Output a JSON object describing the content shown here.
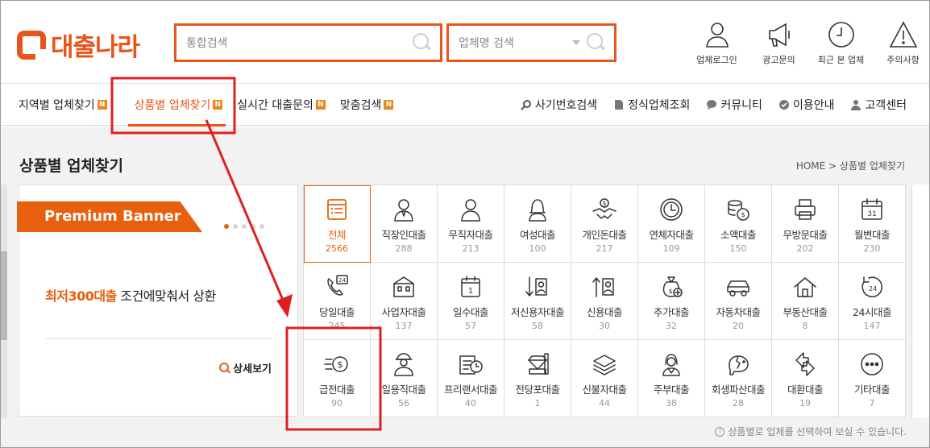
{
  "header": {
    "logo_text": "대출나라",
    "search_total_placeholder": "통합검색",
    "search_company_placeholder": "업체명 검색",
    "icons": [
      {
        "name": "user-icon",
        "label": "업체로그인"
      },
      {
        "name": "megaphone-icon",
        "label": "광고문의"
      },
      {
        "name": "clock-icon",
        "label": "최근 본 업체"
      },
      {
        "name": "warning-icon",
        "label": "주의사항"
      }
    ]
  },
  "nav": {
    "left": [
      {
        "label": "지역별 업체찾기",
        "badge": "N"
      },
      {
        "label": "상품별 업체찾기",
        "badge": "N",
        "active": true
      },
      {
        "label": "실시간 대출문의",
        "badge": "N"
      },
      {
        "label": "맞춤검색",
        "badge": "N"
      }
    ],
    "right": [
      {
        "label": "사기번호검색",
        "icon": "search-icon"
      },
      {
        "label": "정식업체조회",
        "icon": "document-icon"
      },
      {
        "label": "커뮤니티",
        "icon": "chat-icon"
      },
      {
        "label": "이용안내",
        "icon": "check-icon"
      },
      {
        "label": "고객센터",
        "icon": "person-icon"
      }
    ]
  },
  "page": {
    "title": "상품별 업체찾기",
    "breadcrumb": "HOME > 상품별 업체찾기"
  },
  "banner": {
    "tag": "Premium Banner",
    "highlight": "최저300대출",
    "text": " 조건에맞춰서 상환",
    "detail_link": "상세보기"
  },
  "categories": [
    {
      "name": "전체",
      "count": "2566",
      "icon": "list-icon"
    },
    {
      "name": "직장인대출",
      "count": "288",
      "icon": "office-worker-icon"
    },
    {
      "name": "무직자대출",
      "count": "213",
      "icon": "person-icon"
    },
    {
      "name": "여성대출",
      "count": "100",
      "icon": "woman-icon"
    },
    {
      "name": "개인돈대출",
      "count": "217",
      "icon": "handshake-icon"
    },
    {
      "name": "연체자대출",
      "count": "109",
      "icon": "clock-icon"
    },
    {
      "name": "소액대출",
      "count": "150",
      "icon": "coins-icon"
    },
    {
      "name": "무방문대출",
      "count": "202",
      "icon": "printer-icon"
    },
    {
      "name": "월변대출",
      "count": "230",
      "icon": "calendar-icon"
    },
    {
      "name": "당일대출",
      "count": "245",
      "icon": "phone-24-icon"
    },
    {
      "name": "사업자대출",
      "count": "137",
      "icon": "building-icon"
    },
    {
      "name": "일수대출",
      "count": "57",
      "icon": "calendar-day-icon"
    },
    {
      "name": "저신용자대출",
      "count": "58",
      "icon": "credit-down-icon"
    },
    {
      "name": "신용대출",
      "count": "30",
      "icon": "credit-up-icon"
    },
    {
      "name": "추가대출",
      "count": "32",
      "icon": "money-bag-icon"
    },
    {
      "name": "자동차대출",
      "count": "20",
      "icon": "car-icon"
    },
    {
      "name": "부동산대출",
      "count": "8",
      "icon": "house-icon"
    },
    {
      "name": "24시대출",
      "count": "147",
      "icon": "clock-24-icon"
    },
    {
      "name": "급전대출",
      "count": "90",
      "icon": "fast-coin-icon"
    },
    {
      "name": "일용직대출",
      "count": "56",
      "icon": "worker-icon"
    },
    {
      "name": "프리랜서대출",
      "count": "40",
      "icon": "freelancer-icon"
    },
    {
      "name": "전당포대출",
      "count": "1",
      "icon": "diamond-icon"
    },
    {
      "name": "신불자대출",
      "count": "44",
      "icon": "cash-stack-icon"
    },
    {
      "name": "주부대출",
      "count": "38",
      "icon": "housewife-icon"
    },
    {
      "name": "회생파산대출",
      "count": "28",
      "icon": "broken-piggy-icon"
    },
    {
      "name": "대환대출",
      "count": "19",
      "icon": "exchange-icon"
    },
    {
      "name": "기타대출",
      "count": "7",
      "icon": "more-icon"
    }
  ],
  "note": "상품별로 업체를 선택하여 보실 수 있습니다.",
  "colors": {
    "accent": "#e8551b",
    "annotation": "#e02020"
  }
}
